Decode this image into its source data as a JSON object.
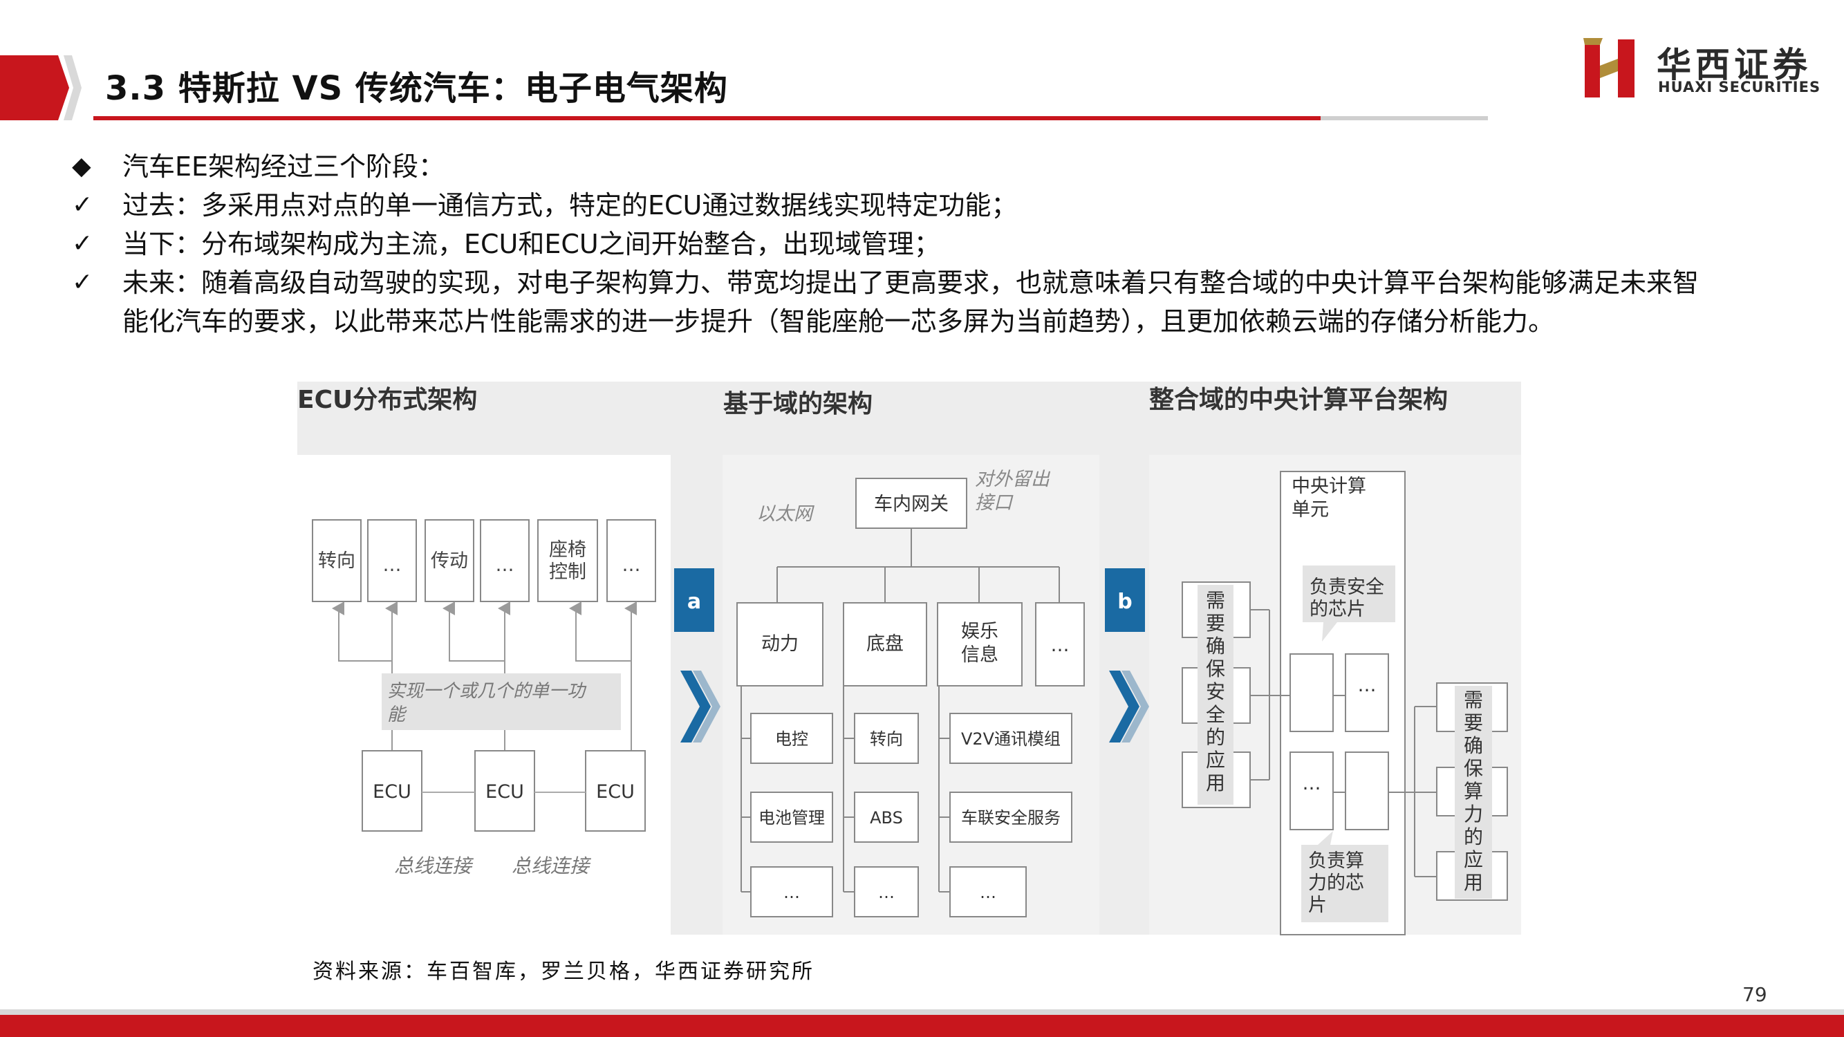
{
  "header": {
    "title": "3.3 特斯拉 VS 传统汽车：电子电气架构",
    "logo_cn": "华西证券",
    "logo_en": "HUAXI SECURITIES",
    "accent_color": "#c8161d"
  },
  "bullets": {
    "heading": "汽车EE架构经过三个阶段：",
    "items": [
      "过去：多采用点对点的单一通信方式，特定的ECU通过数据线实现特定功能；",
      "当下：分布域架构成为主流，ECU和ECU之间开始整合，出现域管理；",
      "未来：随着高级自动驾驶的实现，对电子架构算力、带宽均提出了更高要求，也就意味着只有整合域的中央计算平台架构能够满足未来智",
      "能化汽车的要求，以此带来芯片性能需求的进一步提升（智能座舱一芯多屏为当前趋势），且更加依赖云端的存储分析能力。"
    ],
    "heading_marker": "◆",
    "item_marker": "✓"
  },
  "diagram": {
    "panel1": {
      "title": "ECU分布式架构",
      "top_boxes": [
        "转向",
        "…",
        "传动",
        "…",
        "座椅控制",
        "…"
      ],
      "callout": "实现一个或几个的单一功能",
      "ecus": [
        "ECU",
        "ECU",
        "ECU"
      ],
      "bus_labels": [
        "总线连接",
        "总线连接"
      ]
    },
    "tag_a": "a",
    "panel2": {
      "title": "基于域的架构",
      "gateway": "车内网关",
      "ethernet": "以太网",
      "external_port": "对外留出接口",
      "domains": [
        "动力",
        "底盘",
        "娱乐信息",
        "…"
      ],
      "col1": [
        "电控",
        "电池管理",
        "…"
      ],
      "col2": [
        "转向",
        "ABS",
        "…"
      ],
      "col3": [
        "V2V通讯模组",
        "车联安全服务",
        "…"
      ]
    },
    "tag_b": "b",
    "panel3": {
      "title": "整合域的中央计算平台架构",
      "central": "中央计算单元",
      "safety_chip": "负责安全的芯片",
      "compute_chip": "负责算力的芯片",
      "left_label": "需要确保安全的应用",
      "right_label": "需要确保算力的应用",
      "dots": "…"
    }
  },
  "source": "资料来源：车百智库，罗兰贝格，华西证券研究所",
  "page_number": "79"
}
